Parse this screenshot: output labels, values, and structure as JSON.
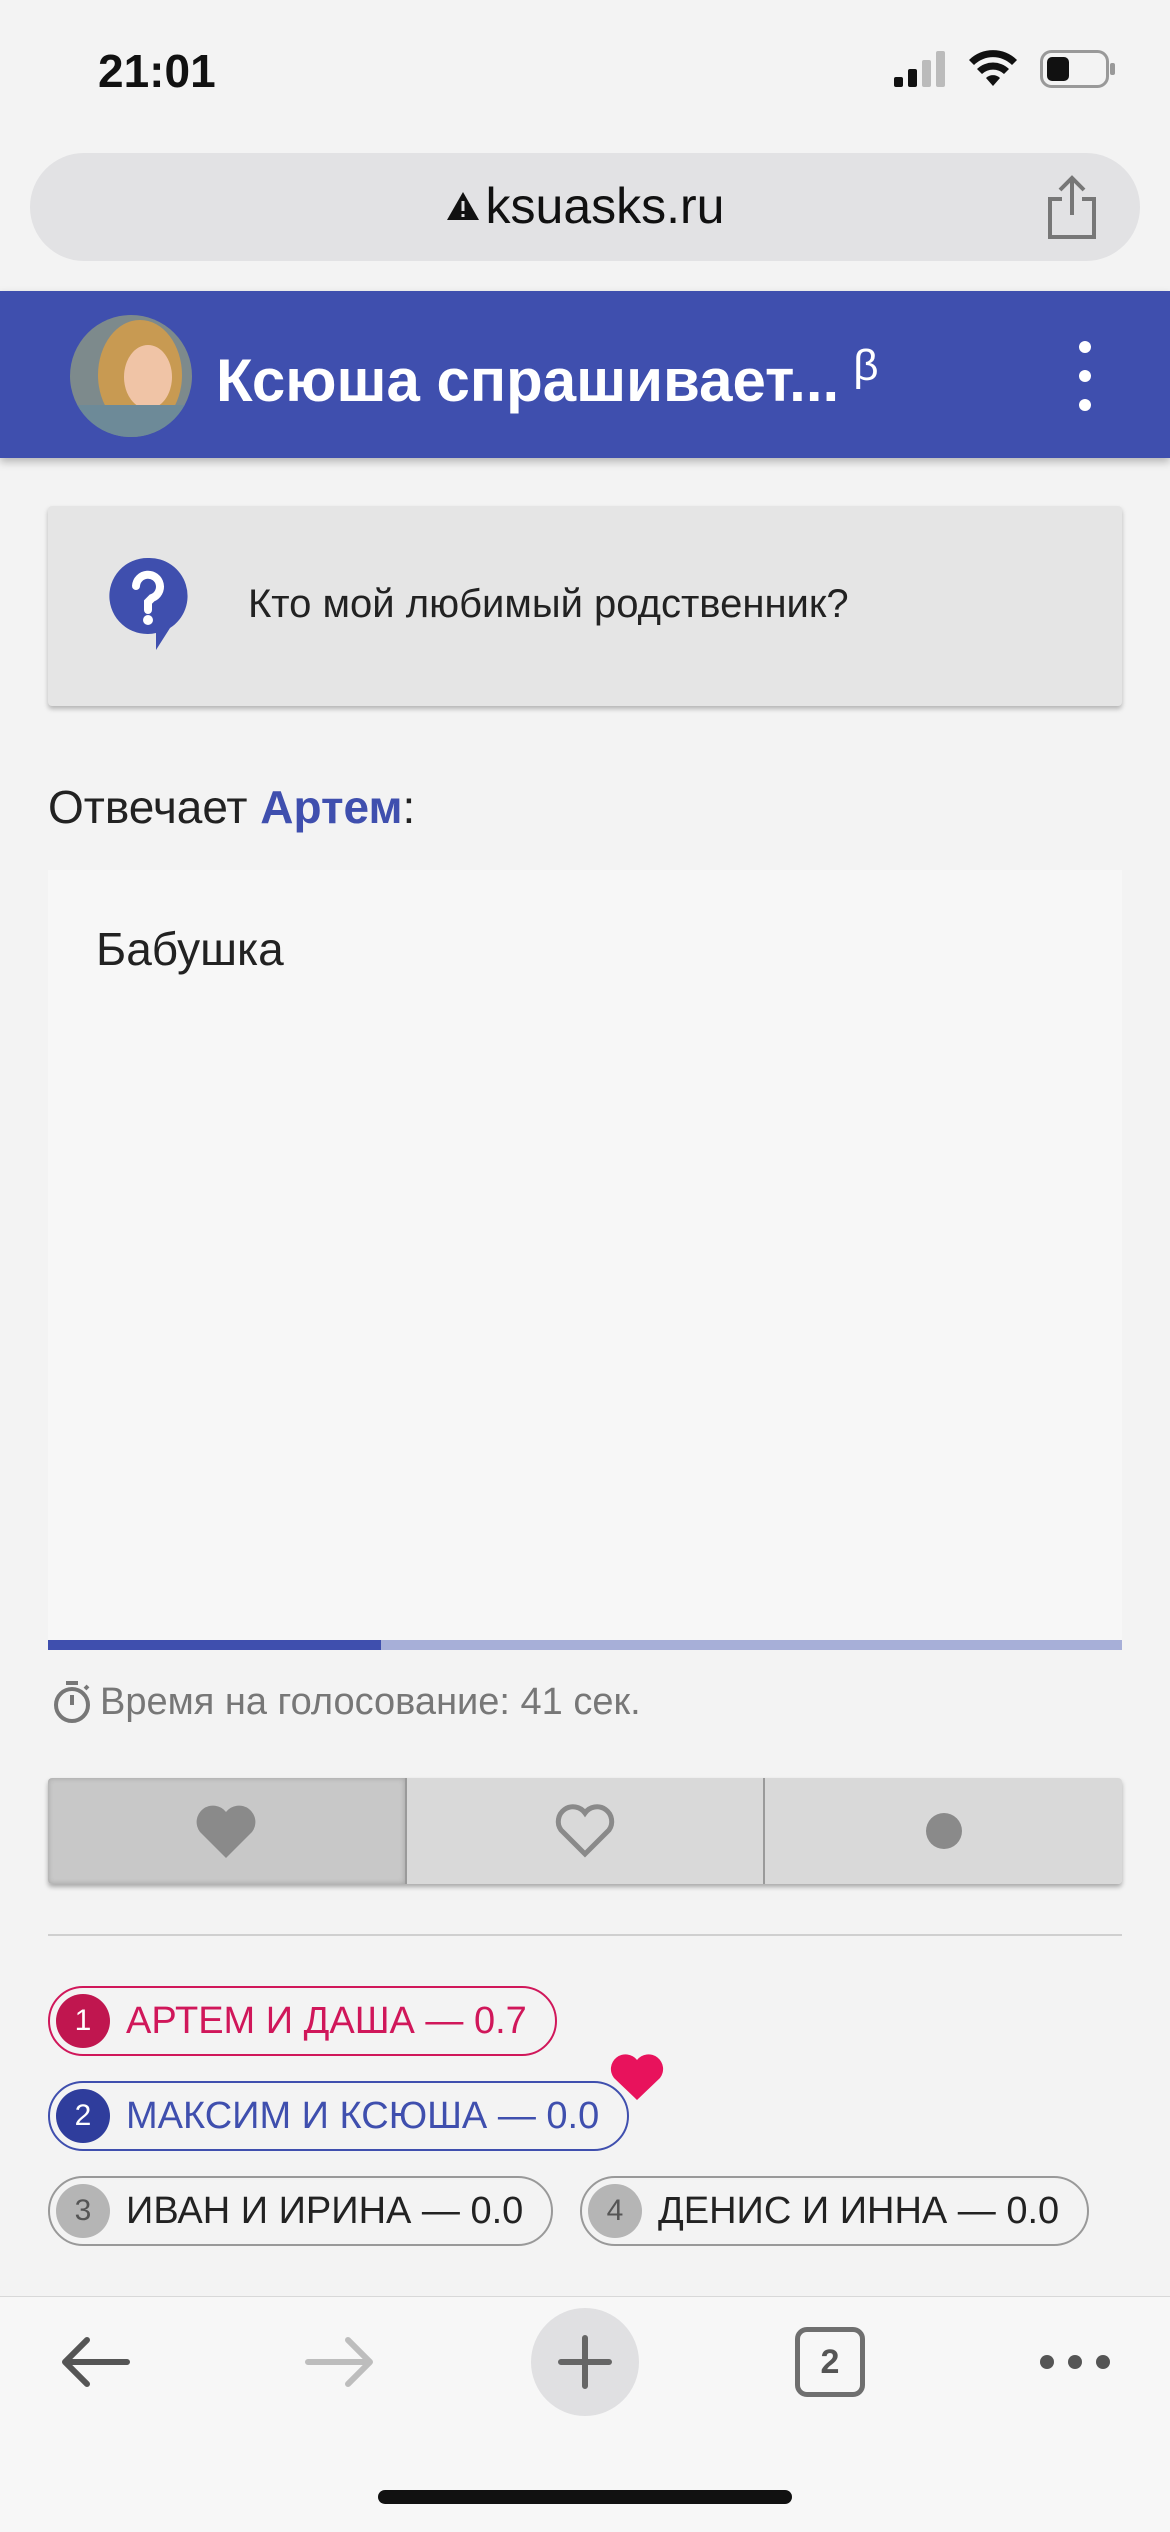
{
  "status": {
    "time": "21:01"
  },
  "browser": {
    "url": "ksuasks.ru",
    "tab_count": "2"
  },
  "header": {
    "title": "Ксюша спрашивает...",
    "beta_mark": "β"
  },
  "question": {
    "text": "Кто мой любимый родственник?"
  },
  "answer": {
    "prefix": "Отвечает ",
    "name": "Артем",
    "suffix": ":",
    "text": "Бабушка"
  },
  "voting": {
    "progress_fraction": 0.31,
    "timer_text": "Время на голосование: 41 сек.",
    "buttons": [
      "heart-filled",
      "heart-outline",
      "dot"
    ],
    "active_button": 0
  },
  "rankings": [
    {
      "rank": "1",
      "label": "АРТЕМ И ДАША — 0.7"
    },
    {
      "rank": "2",
      "label": "МАКСИМ И КСЮША — 0.0"
    },
    {
      "rank": "3",
      "label": "ИВАН И ИРИНА — 0.0"
    },
    {
      "rank": "4",
      "label": "ДЕНИС И ИННА — 0.0"
    }
  ],
  "colors": {
    "primary": "#3f4fae",
    "accent": "#d0175a",
    "heart": "#e8125c"
  }
}
